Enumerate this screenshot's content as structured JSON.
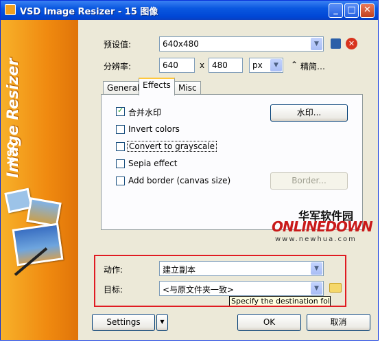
{
  "window": {
    "title": "VSD Image Resizer - 15 图像"
  },
  "sidebar": {
    "brand": "Image Resizer",
    "logo": "VSO"
  },
  "preset": {
    "label": "预设值:",
    "value": "640x480"
  },
  "resolution": {
    "label": "分辨率:",
    "width": "640",
    "separator": "x",
    "height": "480",
    "unit": "px",
    "more": "精简…"
  },
  "tabs": [
    {
      "label": "General"
    },
    {
      "label": "Effects"
    },
    {
      "label": "Misc"
    }
  ],
  "effects": {
    "options": [
      {
        "label": "合并水印",
        "checked": true
      },
      {
        "label": "Invert colors",
        "checked": false
      },
      {
        "label": "Convert to grayscale",
        "checked": false
      },
      {
        "label": "Sepia effect",
        "checked": false
      },
      {
        "label": "Add border (canvas size)",
        "checked": false
      }
    ],
    "watermark_button": "水印...",
    "border_button": "Border..."
  },
  "action": {
    "label": "动作:",
    "value": "建立副本"
  },
  "target": {
    "label": "目标:",
    "value": "<与原文件夹一致>",
    "tooltip": "Specify the destination folder"
  },
  "footer": {
    "settings": "Settings",
    "ok": "OK",
    "cancel": "取消"
  },
  "watermark": {
    "cn": "华军软件园",
    "en": "ONLINEDOWN",
    "url": "www.newhua.com"
  },
  "colors": {
    "titlebar": "#0a58e0",
    "sidebar": "#f08a10",
    "highlight": "#e01b22",
    "checkmark": "#21a121"
  }
}
